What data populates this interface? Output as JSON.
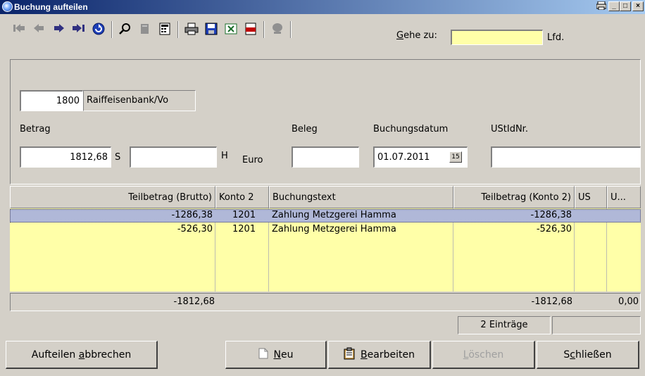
{
  "window": {
    "title": "Buchung aufteilen",
    "controls": [
      "print-icon",
      "minimize-icon",
      "maximize-icon",
      "close-icon"
    ]
  },
  "toolbar": {
    "icons": [
      "first-record-icon",
      "previous-record-icon",
      "next-record-icon",
      "last-record-icon",
      "refresh-icon",
      "search-icon",
      "bookmark-icon",
      "calculator-icon",
      "print-icon",
      "save-icon",
      "excel-icon",
      "pdf-icon",
      "notes-icon"
    ],
    "goto_label_pre": "",
    "goto_label_key": "G",
    "goto_label_post": "ehe zu:",
    "goto_value": "",
    "lfd_label": "Lfd."
  },
  "form": {
    "account_number": "1800",
    "account_name": "Raiffeisenbank/Vo",
    "betrag_label": "Betrag",
    "soll_value": "1812,68",
    "soll_marker": "S",
    "haben_value": "",
    "haben_marker": "H",
    "currency": "Euro",
    "beleg_label": "Beleg",
    "beleg_value": "",
    "buchungsdatum_label": "Buchungsdatum",
    "buchungsdatum_value": "01.07.2011",
    "calendar_icon_text": "15",
    "ustid_label": "UStIdNr.",
    "ustid_value": ""
  },
  "grid": {
    "columns": [
      "Teilbetrag (Brutto)",
      "Konto 2",
      "Buchungstext",
      "Teilbetrag (Konto 2)",
      "US",
      "U..."
    ],
    "rows": [
      {
        "brutto": "-1286,38",
        "konto2": "1201",
        "text": "Zahlung Metzgerei Hamma",
        "betrag_konto2": "-1286,38",
        "us": "",
        "u": ""
      },
      {
        "brutto": "-526,30",
        "konto2": "1201",
        "text": "Zahlung Metzgerei Hamma",
        "betrag_konto2": "-526,30",
        "us": "",
        "u": ""
      }
    ],
    "selected_row": 0
  },
  "totals": {
    "brutto": "-1812,68",
    "konto2": "-1812,68",
    "last": "0,00"
  },
  "status": {
    "entries": "2 Einträge",
    "extra": ""
  },
  "buttons": {
    "cancel_pre": "Aufteilen ",
    "cancel_key": "a",
    "cancel_post": "bbrechen",
    "new_key": "N",
    "new_post": "eu",
    "edit_key": "B",
    "edit_post": "earbeiten",
    "delete_key": "L",
    "delete_post": "öschen",
    "close_pre": "S",
    "close_key": "c",
    "close_post": "hließen"
  },
  "colors": {
    "title_start": "#0a246a",
    "title_end": "#a6caf0",
    "grid_bg": "#ffffa8",
    "selected_row": "#b0b8d8",
    "window_bg": "#d4d0c8"
  }
}
